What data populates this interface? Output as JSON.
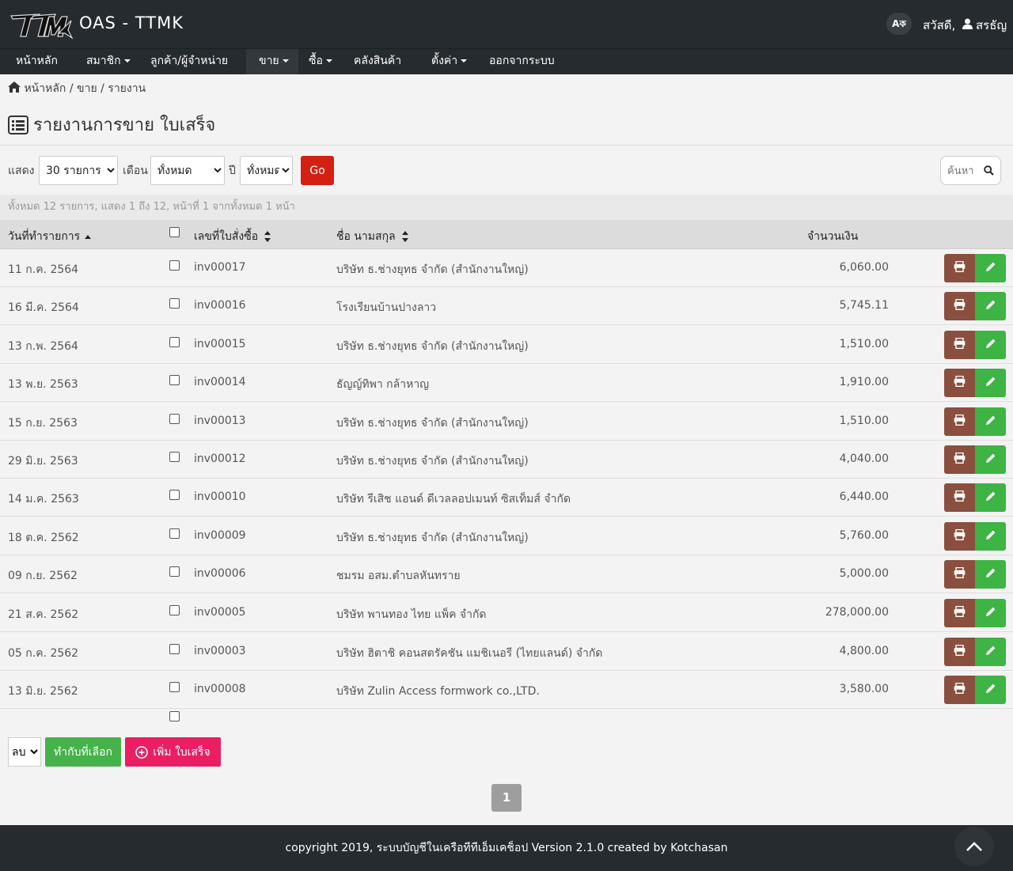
{
  "header": {
    "app_title": "OAS - TTMK",
    "lang_label": "Aক",
    "greeting": "สวัสดี,",
    "username": "สรธัญ"
  },
  "nav": {
    "items": [
      {
        "label": "หน้าหลัก",
        "dropdown": false
      },
      {
        "label": "สมาชิก",
        "dropdown": true
      },
      {
        "label": "ลูกค้า/ผู้จำหน่าย",
        "dropdown": false
      },
      {
        "label": "ขาย",
        "dropdown": true,
        "active": true
      },
      {
        "label": "ซื้อ",
        "dropdown": true
      },
      {
        "label": "คลังสินค้า",
        "dropdown": false
      },
      {
        "label": "ตั้งค่า",
        "dropdown": true
      },
      {
        "label": "ออกจากระบบ",
        "dropdown": false
      }
    ]
  },
  "breadcrumb": {
    "home": "หน้าหลัก",
    "sep": "/",
    "sales": "ขาย",
    "report": "รายงาน"
  },
  "page_title": "รายงานการขาย ใบเสร็จ",
  "filters": {
    "show_label": "แสดง",
    "show_value": "30 รายการ",
    "month_label": "เดือน",
    "month_value": "ทั้งหมด",
    "year_label": "ปี",
    "year_value": "ทั้งหมด",
    "go_label": "Go",
    "search_placeholder": "ค้นหา"
  },
  "summary": "ทั้งหมด 12 รายการ, แสดง 1 ถึง 12, หน้าที่ 1 จากทั้งหมด 1 หน้า",
  "table": {
    "columns": {
      "date": "วันที่ทำรายการ",
      "number": "เลขที่ใบสั่งซื้อ",
      "name": "ชื่อ นามสกุล",
      "amount": "จำนวนเงิน"
    },
    "rows": [
      {
        "date": "11 ก.ค. 2564",
        "number": "inv00017",
        "name": "บริษัท ธ.ช่างยุทธ จำกัด (สำนักงานใหญ่)",
        "amount": "6,060.00"
      },
      {
        "date": "16 มี.ค. 2564",
        "number": "inv00016",
        "name": "โรงเรียนบ้านปางลาว",
        "amount": "5,745.11"
      },
      {
        "date": "13 ก.พ. 2564",
        "number": "inv00015",
        "name": "บริษัท ธ.ช่างยุทธ จำกัด (สำนักงานใหญ่)",
        "amount": "1,510.00"
      },
      {
        "date": "13 พ.ย. 2563",
        "number": "inv00014",
        "name": "ธัญญ์ทิพา กล้าหาญ",
        "amount": "1,910.00"
      },
      {
        "date": "15 ก.ย. 2563",
        "number": "inv00013",
        "name": "บริษัท ธ.ช่างยุทธ จำกัด (สำนักงานใหญ่)",
        "amount": "1,510.00"
      },
      {
        "date": "29 มิ.ย. 2563",
        "number": "inv00012",
        "name": "บริษัท ธ.ช่างยุทธ จำกัด (สำนักงานใหญ่)",
        "amount": "4,040.00"
      },
      {
        "date": "14 ม.ค. 2563",
        "number": "inv00010",
        "name": "บริษัท รีเสิช แอนด์ ดีเวลลอปเมนท์ ซิสเท็มส์ จำกัด",
        "amount": "6,440.00"
      },
      {
        "date": "18 ต.ค. 2562",
        "number": "inv00009",
        "name": "บริษัท ธ.ช่างยุทธ จำกัด (สำนักงานใหญ่)",
        "amount": "5,760.00"
      },
      {
        "date": "09 ก.ย. 2562",
        "number": "inv00006",
        "name": "ชมรม อสม.ตำบลหันทราย",
        "amount": "5,000.00"
      },
      {
        "date": "21 ส.ค. 2562",
        "number": "inv00005",
        "name": "บริษัท พานทอง ไทย แพ็ค จำกัด",
        "amount": "278,000.00"
      },
      {
        "date": "05 ก.ค. 2562",
        "number": "inv00003",
        "name": "บริษัท ฮิตาชิ คอนสตรัคชัน แมชิเนอรี (ไทยแลนด์) จำกัด",
        "amount": "4,800.00"
      },
      {
        "date": "13 มิ.ย. 2562",
        "number": "inv00008",
        "name": "บริษัท Zulin Access formwork co.,LTD.",
        "amount": "3,580.00"
      }
    ]
  },
  "actions": {
    "bulk_value": "ลบ",
    "apply_label": "ทำกับที่เลือก",
    "add_label": "เพิ่ม ใบเสร็จ"
  },
  "pagination": {
    "current": "1"
  },
  "footer": "copyright 2019, ระบบบัญชีในเครือทีทีเอ็มเคช็อป Version 2.1.0 created by Kotchasan",
  "colors": {
    "header_bg": "#262b2f",
    "go_button": "#d42013",
    "print_button": "#8a4f3e",
    "edit_button": "#3db443",
    "apply_button": "#45b24a",
    "add_button": "#e91e63"
  },
  "icons": [
    "logo",
    "translate-icon",
    "user-icon",
    "home-icon",
    "list-icon",
    "search-icon",
    "print-icon",
    "pencil-icon",
    "plus-circle-icon",
    "chevron-up-icon"
  ]
}
